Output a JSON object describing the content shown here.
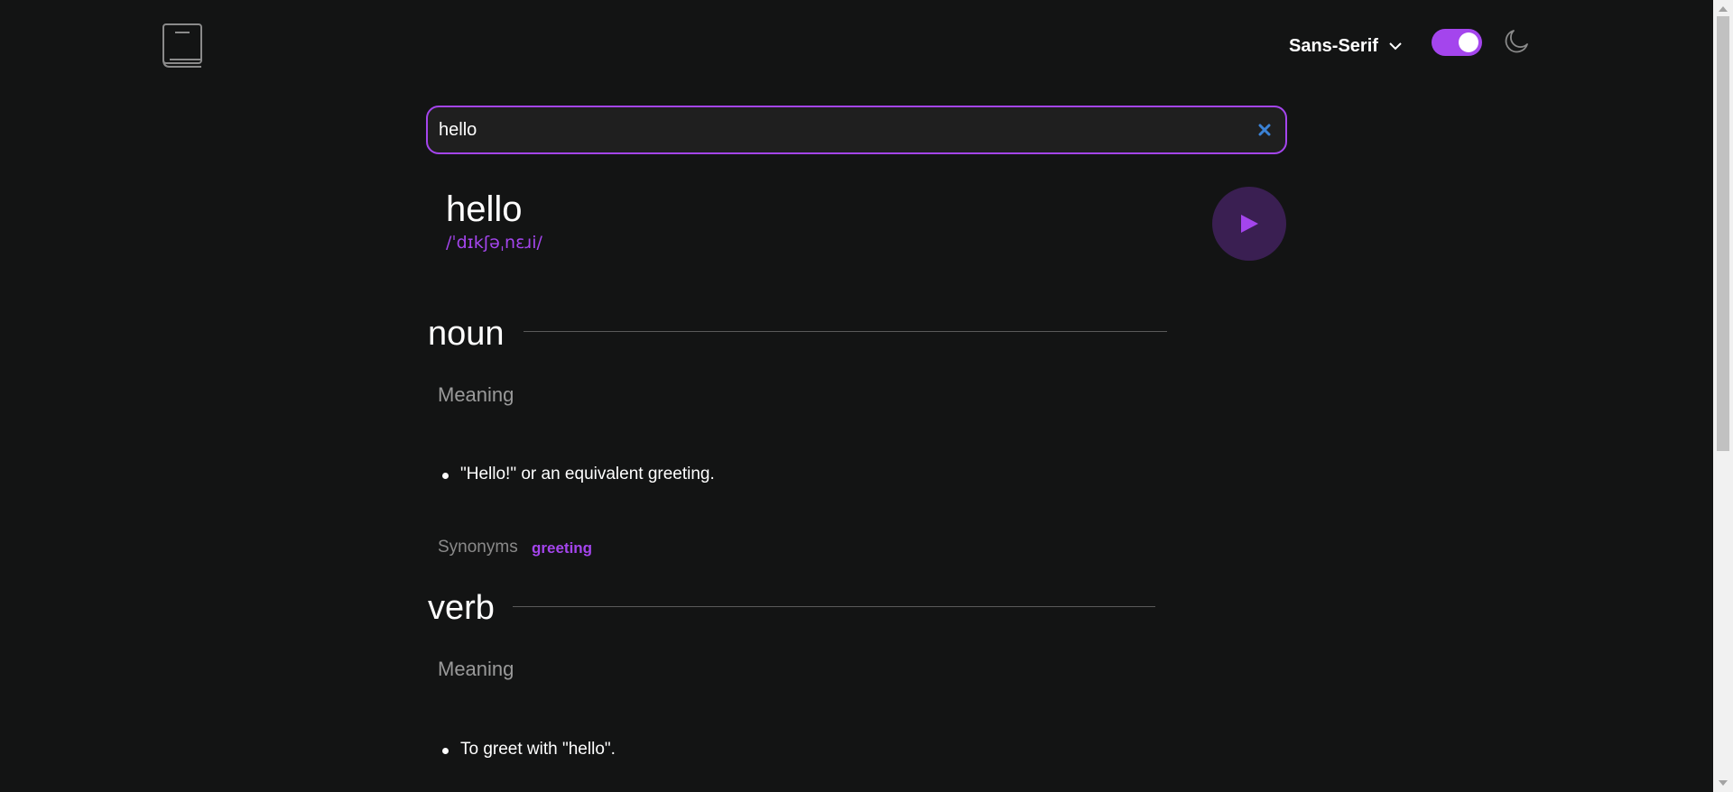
{
  "header": {
    "logo_icon": "book-icon",
    "font_selector": {
      "label": "Sans-Serif",
      "icon": "chevron-down-icon"
    },
    "theme_toggle": {
      "state": "on",
      "accent": "#a445ed"
    },
    "theme_icon": "moon-icon"
  },
  "search": {
    "value": "hello",
    "placeholder": "",
    "clear_icon": "close-icon",
    "clear_color": "#3b82d6"
  },
  "entry": {
    "word": "hello",
    "phonetic": "/ˈdɪkʃəˌnɛɹi/",
    "play_icon": "play-icon"
  },
  "meanings": [
    {
      "part_of_speech": "noun",
      "meaning_label": "Meaning",
      "definitions": [
        "\"Hello!\" or an equivalent greeting."
      ],
      "synonyms_label": "Synonyms",
      "synonyms": [
        "greeting"
      ]
    },
    {
      "part_of_speech": "verb",
      "meaning_label": "Meaning",
      "definitions": [
        "To greet with \"hello\"."
      ]
    }
  ],
  "colors": {
    "background": "#131414",
    "accent": "#a445ed",
    "text": "#ffffff",
    "muted": "#8a8a8a"
  }
}
